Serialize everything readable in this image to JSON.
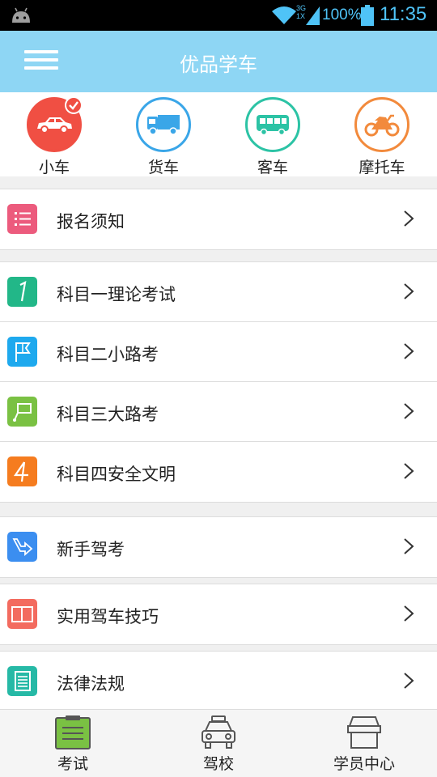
{
  "status_bar": {
    "battery": "100%",
    "time": "11:35",
    "network": "3G",
    "signal_sub": "1X"
  },
  "header": {
    "title": "优品学车"
  },
  "categories": [
    {
      "label": "小车",
      "icon": "car-icon",
      "color": "#f04f43",
      "selected": true
    },
    {
      "label": "货车",
      "icon": "truck-icon",
      "color": "#3aa6e8",
      "selected": false
    },
    {
      "label": "客车",
      "icon": "bus-icon",
      "color": "#2cc3a5",
      "selected": false
    },
    {
      "label": "摩托车",
      "icon": "motorcycle-icon",
      "color": "#f28a3c",
      "selected": false
    }
  ],
  "menu": {
    "registration": {
      "label": "报名须知",
      "icon_color": "#ec5b7d"
    },
    "subject1": {
      "label": "科目一理论考试",
      "icon_color": "#22b788"
    },
    "subject2": {
      "label": "科目二小路考",
      "icon_color": "#1ea9ee"
    },
    "subject3": {
      "label": "科目三大路考",
      "icon_color": "#7ac143"
    },
    "subject4": {
      "label": "科目四安全文明",
      "icon_color": "#f57c1f"
    },
    "beginner": {
      "label": "新手驾考",
      "icon_color": "#3b8ef0"
    },
    "tips": {
      "label": "实用驾车技巧",
      "icon_color": "#f36b5f"
    },
    "laws": {
      "label": "法律法规",
      "icon_color": "#26b9a6"
    }
  },
  "bottom_nav": [
    {
      "label": "考试",
      "icon": "exam-icon",
      "active": true
    },
    {
      "label": "驾校",
      "icon": "school-icon",
      "active": false
    },
    {
      "label": "学员中心",
      "icon": "student-center-icon",
      "active": false
    }
  ]
}
